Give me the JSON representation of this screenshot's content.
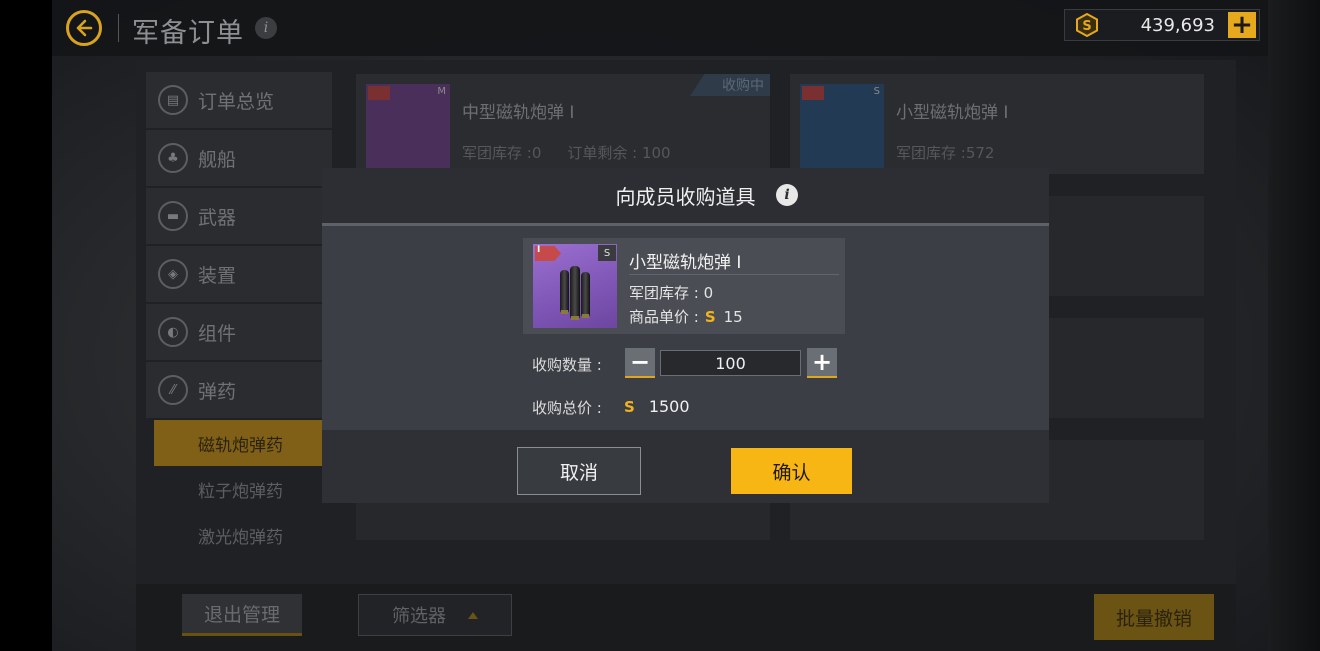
{
  "header": {
    "title": "军备订单",
    "coins": "439,693"
  },
  "sidebar": {
    "items": [
      {
        "label": "订单总览",
        "icon": "clipboard-icon"
      },
      {
        "label": "舰船",
        "icon": "ship-icon"
      },
      {
        "label": "武器",
        "icon": "gun-icon"
      },
      {
        "label": "装置",
        "icon": "device-icon"
      },
      {
        "label": "组件",
        "icon": "component-icon"
      },
      {
        "label": "弹药",
        "icon": "ammo-icon"
      }
    ],
    "subitems": [
      "磁轨炮弹药",
      "粒子炮弹药",
      "激光炮弹药"
    ]
  },
  "cards": [
    {
      "name": "中型磁轨炮弹 I",
      "stock": "军团库存 :0",
      "remaining": "订单剩余 : 100",
      "size": "M",
      "badge": "收购中"
    },
    {
      "name": "小型磁轨炮弹 I",
      "stock": "军团库存 :572",
      "size": "S"
    }
  ],
  "bottombar": {
    "exit_label": "退出管理",
    "filter_label": "筛选器",
    "batch_label": "批量撤销"
  },
  "dialog": {
    "title": "向成员收购道具",
    "item": {
      "tier": "I",
      "size": "S",
      "name": "小型磁轨炮弹 I",
      "stock": "军团库存 : 0",
      "price_label": "商品单价 :",
      "price": "15"
    },
    "qty_label": "收购数量 :",
    "qty_value": "100",
    "total_label": "收购总价 :",
    "total_value": "1500",
    "cancel_label": "取消",
    "confirm_label": "确认"
  },
  "colors": {
    "accent": "#f7b614",
    "coin": "#f2b31c",
    "dialog_bg": "#3b3e44"
  }
}
